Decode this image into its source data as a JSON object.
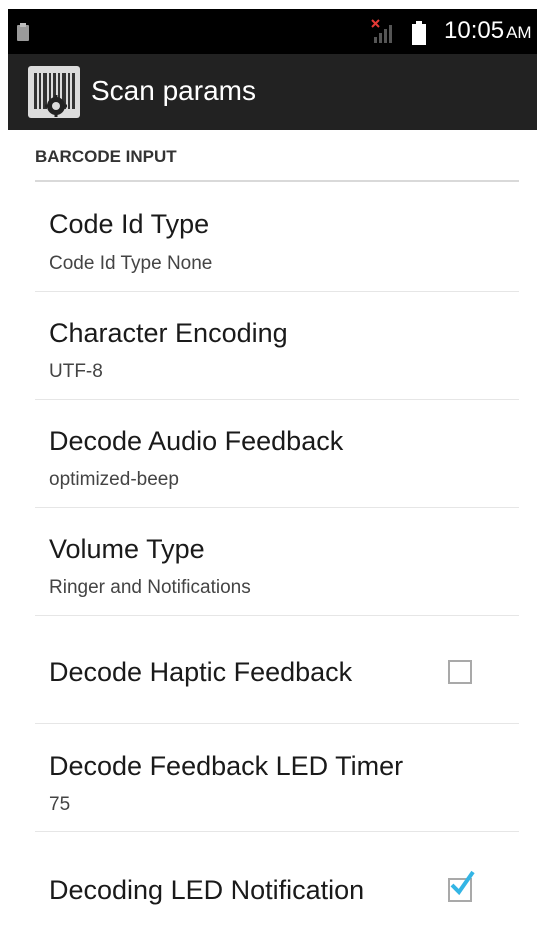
{
  "status_bar": {
    "time": "10:05",
    "ampm": "AM",
    "icons": [
      "clipboard-notification-icon",
      "signal-no-sim-icon",
      "battery-icon"
    ]
  },
  "action_bar": {
    "title": "Scan params",
    "icon": "barcode-settings-icon"
  },
  "category": {
    "label": "BARCODE INPUT"
  },
  "preferences": [
    {
      "title": "Code Id Type",
      "summary": "Code Id Type None"
    },
    {
      "title": "Character Encoding",
      "summary": "UTF-8"
    },
    {
      "title": "Decode Audio Feedback",
      "summary": "optimized-beep"
    },
    {
      "title": "Volume Type",
      "summary": "Ringer and Notifications"
    },
    {
      "title": "Decode Haptic Feedback",
      "checked": false
    },
    {
      "title": "Decode Feedback LED Timer",
      "summary": "75"
    },
    {
      "title": "Decoding LED Notification",
      "checked": true
    }
  ],
  "colors": {
    "status_bar": "#000000",
    "action_bar": "#222222",
    "checkmark": "#33b5e5"
  }
}
